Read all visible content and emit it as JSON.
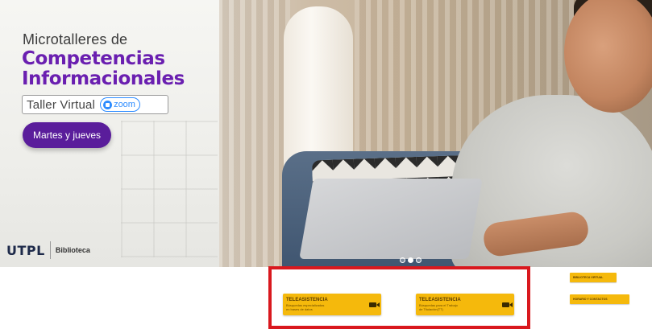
{
  "hero": {
    "title_line1": "Microtalleres de",
    "title_line2": "Competencias",
    "title_line3": "Informacionales",
    "taller_label": "Taller Virtual",
    "zoom_label": "zoom",
    "cta_label": "Martes y jueves",
    "logo_mark": "UTPL",
    "logo_text": "Biblioteca",
    "carousel": {
      "slides": 3,
      "active_index": 1
    }
  },
  "services": {
    "items": [
      {
        "title": "TELEASISTENCIA",
        "subtitle_line1": "Búsquedas especializadas",
        "subtitle_line2": "en bases de datos"
      },
      {
        "title": "TELEASISTENCIA",
        "subtitle_line1": "Búsquedas para el Trabajo",
        "subtitle_line2": "de Titulación(TT)"
      }
    ],
    "side_links": [
      {
        "label": "BIBLIOTECA VIRTUAL"
      },
      {
        "label": "HORARIO Y CONTACTOS"
      }
    ]
  },
  "colors": {
    "brand_purple": "#6a1fb0",
    "button_purple": "#5a1d9b",
    "service_yellow": "#f5b90c",
    "highlight_red": "#d9181e",
    "zoom_blue": "#2d8cff"
  }
}
